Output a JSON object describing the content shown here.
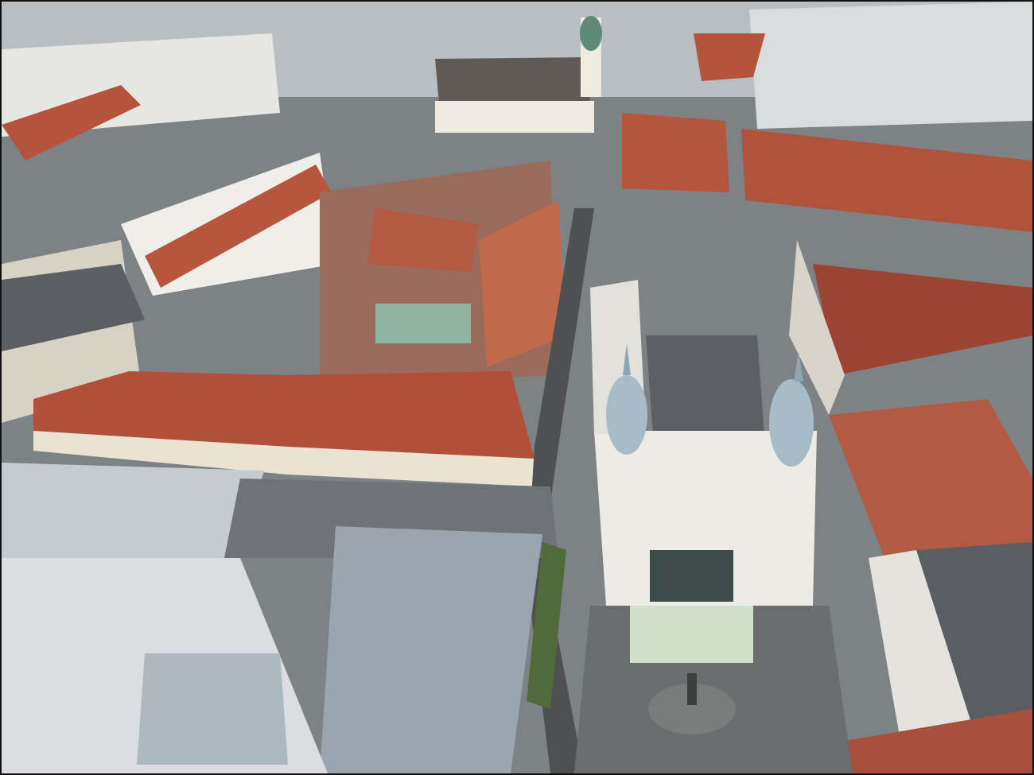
{
  "image": {
    "kind": "aerial-photo",
    "description_visible_text": [],
    "palette": {
      "roof_red": "#b5533c",
      "roof_red_dark": "#8e3f2f",
      "roof_grey": "#6f7478",
      "roof_zinc": "#a6b2bb",
      "facade_cream": "#e9e2d3",
      "facade_white": "#f1f0ec",
      "street": "#5d5f61",
      "dome_blue": "#9fb6c2",
      "umbrella_green": "#c9dcc3",
      "tree_green": "#4f6b3a"
    }
  }
}
